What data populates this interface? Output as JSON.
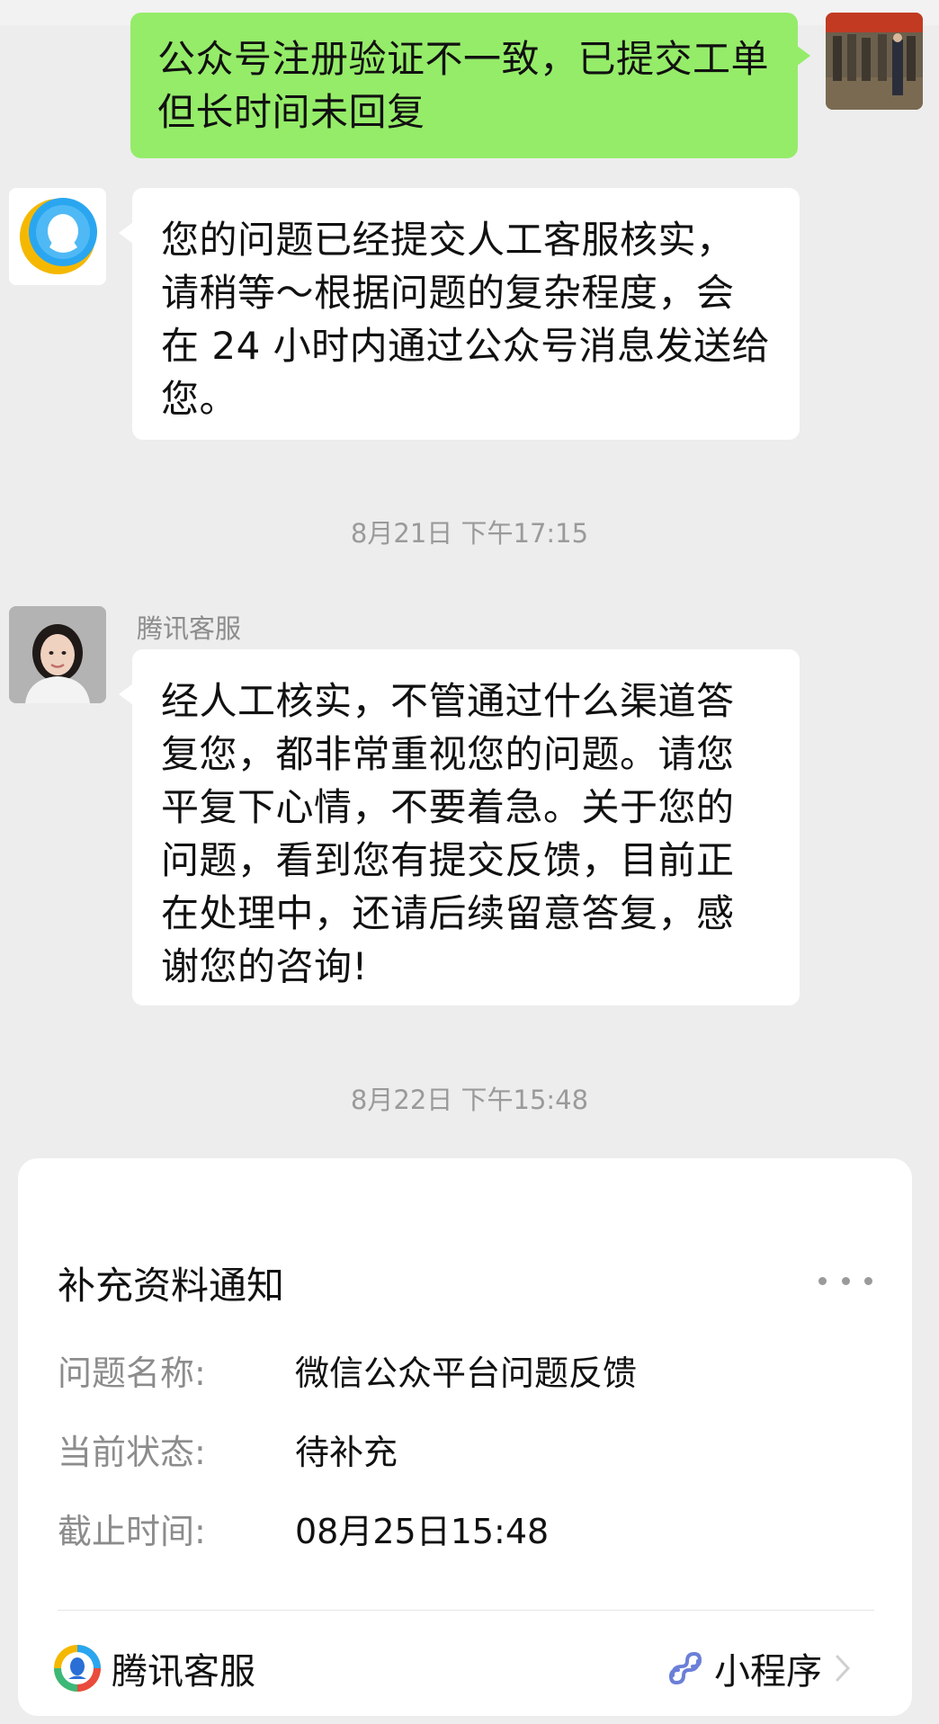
{
  "conversation": {
    "user_message": "公众号注册验证不一致，已提交工单但长时间未回复",
    "bot_message": "您的问题已经提交人工客服核实，请稍等～根据问题的复杂程度，会在 24 小时内通过公众号消息发送给您。",
    "timestamp_1": "8月21日 下午17:15",
    "agent_name": "腾讯客服",
    "agent_message": "经人工核实，不管通过什么渠道答复您，都非常重视您的问题。请您平复下心情，不要着急。关于您的问题，看到您有提交反馈，目前正在处理中，还请后续留意答复，感谢您的咨询!",
    "timestamp_2": "8月22日 下午15:48"
  },
  "card": {
    "title": "补充资料通知",
    "more_icon": "more-dots-icon",
    "rows": [
      {
        "label": "问题名称:",
        "value": "微信公众平台问题反馈"
      },
      {
        "label": "当前状态:",
        "value": "待补充"
      },
      {
        "label": "截止时间:",
        "value": "08月25日15:48"
      }
    ],
    "footer": {
      "brand_name": "腾讯客服",
      "brand_icon": "tencent-service-logo",
      "miniapp_label": "小程序",
      "miniapp_icon": "miniprogram-link-icon"
    }
  },
  "colors": {
    "background": "#ededed",
    "sent_bubble": "#95ec69",
    "received_bubble": "#ffffff",
    "bot_logo_blue": "#2aa6f0",
    "bot_logo_yellow": "#f5b800",
    "miniprogram_icon": "#6c7fd8"
  }
}
